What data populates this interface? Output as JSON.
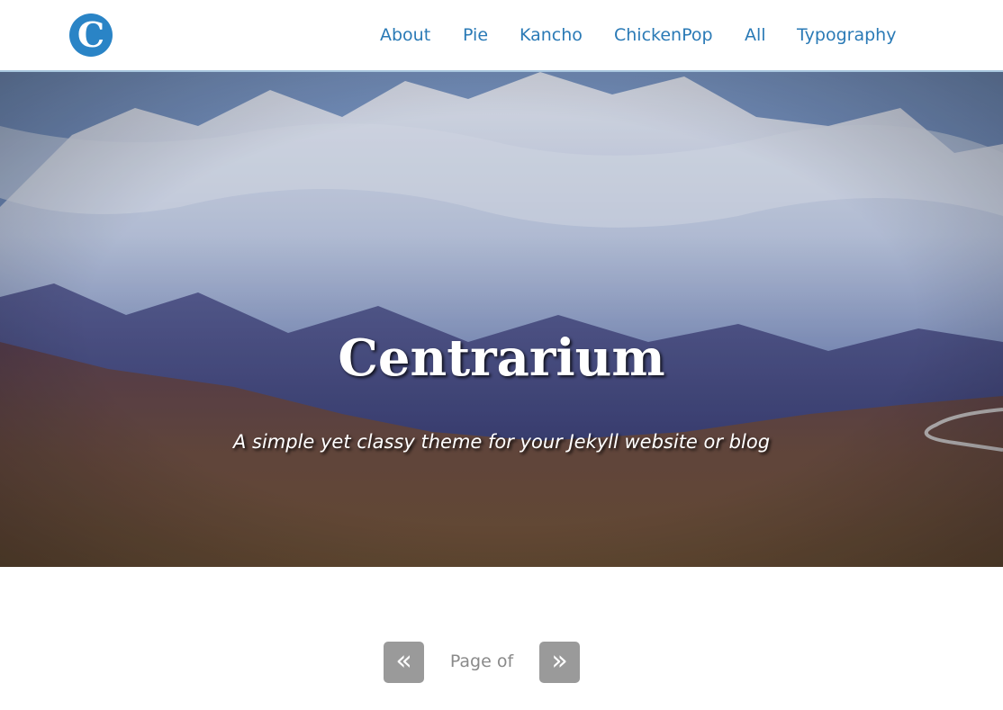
{
  "header": {
    "logo_letter": "C",
    "nav": [
      {
        "label": "About"
      },
      {
        "label": "Pie"
      },
      {
        "label": "Kancho"
      },
      {
        "label": "ChickenPop"
      },
      {
        "label": "All"
      },
      {
        "label": "Typography"
      }
    ]
  },
  "hero": {
    "title": "Centrarium",
    "subtitle": "A simple yet classy theme for your Jekyll website or blog"
  },
  "pagination": {
    "prev_icon": "«",
    "label": "Page of",
    "next_icon": "»"
  },
  "colors": {
    "accent": "#2a84c6",
    "nav_link": "#2a7ab6",
    "pager_button": "#9a9a9a"
  }
}
